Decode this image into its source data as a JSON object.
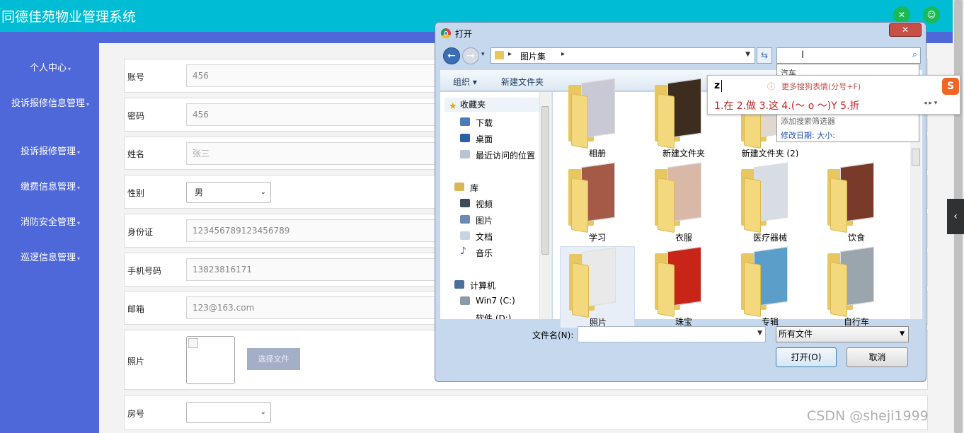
{
  "app": {
    "title": "同德佳苑物业管理系统"
  },
  "header": {
    "fullscreen_icon": "expand-icon",
    "user_icon": "user-icon"
  },
  "sidebar": {
    "items": [
      {
        "label": "个人中心"
      },
      {
        "label": "投诉报修信息管理"
      },
      {
        "label": "投诉报修管理"
      },
      {
        "label": "缴费信息管理"
      },
      {
        "label": "消防安全管理"
      },
      {
        "label": "巡逻信息管理"
      }
    ]
  },
  "form": {
    "account": {
      "label": "账号",
      "value": "456"
    },
    "password": {
      "label": "密码",
      "value": "456"
    },
    "name": {
      "label": "姓名",
      "placeholder": "张三"
    },
    "gender": {
      "label": "性别",
      "value": "男"
    },
    "id_card": {
      "label": "身份证",
      "value": "123456789123456789"
    },
    "phone": {
      "label": "手机号码",
      "value": "13823816171"
    },
    "email": {
      "label": "邮箱",
      "value": "123@163.com"
    },
    "photo": {
      "label": "照片",
      "button": "选择文件"
    },
    "room": {
      "label": "房号",
      "value": ""
    }
  },
  "dialog": {
    "title": "打开",
    "close": "✕",
    "path": "图片集",
    "toolbar": {
      "organize": "组织 ▾",
      "new_folder": "新建文件夹"
    },
    "tree": {
      "favorites": "收藏夹",
      "downloads": "下载",
      "desktop": "桌面",
      "recent": "最近访问的位置",
      "library": "库",
      "video": "视频",
      "pictures": "图片",
      "documents": "文档",
      "music": "音乐",
      "computer": "计算机",
      "drive_c": "Win7 (C:)",
      "drive_d": "软件 (D:)"
    },
    "folders": [
      {
        "name": "相册",
        "color": "#c9c9d6"
      },
      {
        "name": "新建文件夹",
        "color": "#3d2d1f"
      },
      {
        "name": "新建文件夹 (2)",
        "color": "#e0d8d0"
      },
      {
        "name": "学习",
        "color": "#a55a48"
      },
      {
        "name": "衣服",
        "color": "#d9b8a8"
      },
      {
        "name": "医疗器械",
        "color": "#d8dde3"
      },
      {
        "name": "饮食",
        "color": "#7a3a2a"
      },
      {
        "name": "照片",
        "color": "#e9e9e9"
      },
      {
        "name": "珠宝",
        "color": "#c82418"
      },
      {
        "name": "专辑",
        "color": "#5b9ec9"
      },
      {
        "name": "自行车",
        "color": "#9aa5ae"
      }
    ],
    "filename_label": "文件名(N):",
    "filename_value": "",
    "filetype": "所有文件",
    "open_button": "打开(O)",
    "cancel_button": "取消"
  },
  "search_suggestions": {
    "item": "汽车",
    "add_filter": "添加搜索筛选器",
    "filters": "修改日期:   大小:"
  },
  "ime": {
    "typed": "z",
    "more": "更多搜狗表情(分号+F)",
    "candidates": "1.在  2.做  3.这  4.(～ o ～)Y  5.折",
    "pager": "◂ ▸  ▾",
    "logo": "S"
  },
  "watermark": "CSDN @sheji1999",
  "side_tab": "‹"
}
